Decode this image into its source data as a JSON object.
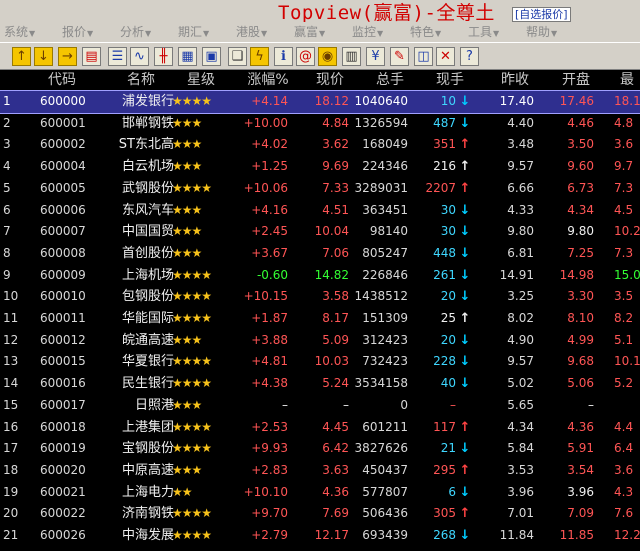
{
  "title_bar": {
    "app_title": "Topview(赢富)-全尊土",
    "view_tag": "[自选报价]"
  },
  "menu": [
    {
      "label": "系统"
    },
    {
      "label": "报价"
    },
    {
      "label": "分析"
    },
    {
      "label": "期汇"
    },
    {
      "label": "港股"
    },
    {
      "label": "赢富"
    },
    {
      "label": "监控"
    },
    {
      "label": "特色"
    },
    {
      "label": "工具"
    },
    {
      "label": "帮助"
    }
  ],
  "toolbar": [
    {
      "icon": "arrow-up-icon",
      "glyph": "↑"
    },
    {
      "icon": "arrow-down-icon",
      "glyph": "↓"
    },
    {
      "icon": "arrow-right-icon",
      "glyph": "→"
    },
    {
      "icon": "report-icon",
      "glyph": "▤"
    },
    {
      "icon": "list-icon",
      "glyph": "☰"
    },
    {
      "icon": "line-chart-icon",
      "glyph": "∿"
    },
    {
      "icon": "kline-chart-icon",
      "glyph": "╫"
    },
    {
      "icon": "grid-icon",
      "glyph": "▦"
    },
    {
      "icon": "calculator-icon",
      "glyph": "▣"
    },
    {
      "icon": "book-icon",
      "glyph": "❑"
    },
    {
      "icon": "lightning-icon",
      "glyph": "ϟ"
    },
    {
      "icon": "info-icon",
      "glyph": "ℹ"
    },
    {
      "icon": "email-icon",
      "glyph": "@"
    },
    {
      "icon": "coin-icon",
      "glyph": "◉"
    },
    {
      "icon": "news-icon",
      "glyph": "▥"
    },
    {
      "icon": "bag-icon",
      "glyph": "¥"
    },
    {
      "icon": "pencil-icon",
      "glyph": "✎"
    },
    {
      "icon": "chart-window-icon",
      "glyph": "◫"
    },
    {
      "icon": "tools-icon",
      "glyph": "✕"
    },
    {
      "icon": "help-icon",
      "glyph": "?"
    }
  ],
  "columns": [
    "代码",
    "名称",
    "星级",
    "涨幅%",
    "现价",
    "总手",
    "现手",
    "昨收",
    "开盘",
    "最"
  ],
  "colors": {
    "up": "#ff5555",
    "down": "#33ff33",
    "flat": "#f0f0f0",
    "selected_row": "#2f2f8f",
    "star": "#f7c21b"
  },
  "rows": [
    {
      "idx": "1",
      "code": "600000",
      "name": "浦发银行",
      "stars": "★★★★",
      "change": "+4.14",
      "price": "18.12",
      "volume": "1040640",
      "cur_vol": "10",
      "dir": "down",
      "prev_close": "17.40",
      "open": "17.46",
      "high": "18.1",
      "trend": "up",
      "open_trend": "up",
      "selected": true
    },
    {
      "idx": "2",
      "code": "600001",
      "name": "邯郸钢铁",
      "stars": "★★★",
      "change": "+10.00",
      "price": "4.84",
      "volume": "1326594",
      "cur_vol": "487",
      "dir": "down",
      "prev_close": "4.40",
      "open": "4.46",
      "high": "4.8",
      "trend": "up",
      "open_trend": "up"
    },
    {
      "idx": "3",
      "code": "600002",
      "name": "ST东北高",
      "stars": "★★★",
      "change": "+4.02",
      "price": "3.62",
      "volume": "168049",
      "cur_vol": "351",
      "dir": "up",
      "prev_close": "3.48",
      "open": "3.50",
      "high": "3.6",
      "trend": "up",
      "open_trend": "up"
    },
    {
      "idx": "4",
      "code": "600004",
      "name": "白云机场",
      "stars": "★★★",
      "change": "+1.25",
      "price": "9.69",
      "volume": "224346",
      "cur_vol": "216",
      "dir": "upw",
      "prev_close": "9.57",
      "open": "9.60",
      "high": "9.7",
      "trend": "up",
      "open_trend": "up"
    },
    {
      "idx": "5",
      "code": "600005",
      "name": "武钢股份",
      "stars": "★★★★",
      "change": "+10.06",
      "price": "7.33",
      "volume": "3289031",
      "cur_vol": "2207",
      "dir": "up",
      "prev_close": "6.66",
      "open": "6.73",
      "high": "7.3",
      "trend": "up",
      "open_trend": "up"
    },
    {
      "idx": "6",
      "code": "600006",
      "name": "东风汽车",
      "stars": "★★★",
      "change": "+4.16",
      "price": "4.51",
      "volume": "363451",
      "cur_vol": "30",
      "dir": "down",
      "prev_close": "4.33",
      "open": "4.34",
      "high": "4.5",
      "trend": "up",
      "open_trend": "up"
    },
    {
      "idx": "7",
      "code": "600007",
      "name": "中国国贸",
      "stars": "★★★",
      "change": "+2.45",
      "price": "10.04",
      "volume": "98140",
      "cur_vol": "30",
      "dir": "down",
      "prev_close": "9.80",
      "open": "9.80",
      "high": "10.2",
      "trend": "up",
      "open_trend": "flat"
    },
    {
      "idx": "8",
      "code": "600008",
      "name": "首创股份",
      "stars": "★★★",
      "change": "+3.67",
      "price": "7.06",
      "volume": "805247",
      "cur_vol": "448",
      "dir": "down",
      "prev_close": "6.81",
      "open": "7.25",
      "high": "7.3",
      "trend": "up",
      "open_trend": "up"
    },
    {
      "idx": "9",
      "code": "600009",
      "name": "上海机场",
      "stars": "★★★★",
      "change": "-0.60",
      "price": "14.82",
      "volume": "226846",
      "cur_vol": "261",
      "dir": "down",
      "prev_close": "14.91",
      "open": "14.98",
      "high": "15.0",
      "trend": "down",
      "open_trend": "up"
    },
    {
      "idx": "10",
      "code": "600010",
      "name": "包钢股份",
      "stars": "★★★★",
      "change": "+10.15",
      "price": "3.58",
      "volume": "1438512",
      "cur_vol": "20",
      "dir": "down",
      "prev_close": "3.25",
      "open": "3.30",
      "high": "3.5",
      "trend": "up",
      "open_trend": "up"
    },
    {
      "idx": "11",
      "code": "600011",
      "name": "华能国际",
      "stars": "★★★★",
      "change": "+1.87",
      "price": "8.17",
      "volume": "151309",
      "cur_vol": "25",
      "dir": "upw",
      "prev_close": "8.02",
      "open": "8.10",
      "high": "8.2",
      "trend": "up",
      "open_trend": "up"
    },
    {
      "idx": "12",
      "code": "600012",
      "name": "皖通高速",
      "stars": "★★★",
      "change": "+3.88",
      "price": "5.09",
      "volume": "312423",
      "cur_vol": "20",
      "dir": "down",
      "prev_close": "4.90",
      "open": "4.99",
      "high": "5.1",
      "trend": "up",
      "open_trend": "up"
    },
    {
      "idx": "13",
      "code": "600015",
      "name": "华夏银行",
      "stars": "★★★★",
      "change": "+4.81",
      "price": "10.03",
      "volume": "732423",
      "cur_vol": "228",
      "dir": "down",
      "prev_close": "9.57",
      "open": "9.68",
      "high": "10.1",
      "trend": "up",
      "open_trend": "up"
    },
    {
      "idx": "14",
      "code": "600016",
      "name": "民生银行",
      "stars": "★★★★",
      "change": "+4.38",
      "price": "5.24",
      "volume": "3534158",
      "cur_vol": "40",
      "dir": "down",
      "prev_close": "5.02",
      "open": "5.06",
      "high": "5.2",
      "trend": "up",
      "open_trend": "up"
    },
    {
      "idx": "15",
      "code": "600017",
      "name": "日照港",
      "stars": "★★★",
      "change": "–",
      "price": "–",
      "volume": "0",
      "cur_vol": "–",
      "dir": "none",
      "prev_close": "5.65",
      "open": "–",
      "high": "",
      "trend": "flat",
      "open_trend": "flat",
      "suspended": true
    },
    {
      "idx": "16",
      "code": "600018",
      "name": "上港集团",
      "stars": "★★★★",
      "change": "+2.53",
      "price": "4.45",
      "volume": "601211",
      "cur_vol": "117",
      "dir": "up",
      "prev_close": "4.34",
      "open": "4.36",
      "high": "4.4",
      "trend": "up",
      "open_trend": "up"
    },
    {
      "idx": "17",
      "code": "600019",
      "name": "宝钢股份",
      "stars": "★★★★",
      "change": "+9.93",
      "price": "6.42",
      "volume": "3827626",
      "cur_vol": "21",
      "dir": "down",
      "prev_close": "5.84",
      "open": "5.91",
      "high": "6.4",
      "trend": "up",
      "open_trend": "up"
    },
    {
      "idx": "18",
      "code": "600020",
      "name": "中原高速",
      "stars": "★★★",
      "change": "+2.83",
      "price": "3.63",
      "volume": "450437",
      "cur_vol": "295",
      "dir": "up",
      "prev_close": "3.53",
      "open": "3.54",
      "high": "3.6",
      "trend": "up",
      "open_trend": "up"
    },
    {
      "idx": "19",
      "code": "600021",
      "name": "上海电力",
      "stars": "★★",
      "change": "+10.10",
      "price": "4.36",
      "volume": "577807",
      "cur_vol": "6",
      "dir": "down",
      "prev_close": "3.96",
      "open": "3.96",
      "high": "4.3",
      "trend": "up",
      "open_trend": "flat"
    },
    {
      "idx": "20",
      "code": "600022",
      "name": "济南钢铁",
      "stars": "★★★★",
      "change": "+9.70",
      "price": "7.69",
      "volume": "506436",
      "cur_vol": "305",
      "dir": "up",
      "prev_close": "7.01",
      "open": "7.09",
      "high": "7.6",
      "trend": "up",
      "open_trend": "up"
    },
    {
      "idx": "21",
      "code": "600026",
      "name": "中海发展",
      "stars": "★★★★",
      "change": "+2.79",
      "price": "12.17",
      "volume": "693439",
      "cur_vol": "268",
      "dir": "down",
      "prev_close": "11.84",
      "open": "11.85",
      "high": "12.2",
      "trend": "up",
      "open_trend": "up"
    }
  ]
}
